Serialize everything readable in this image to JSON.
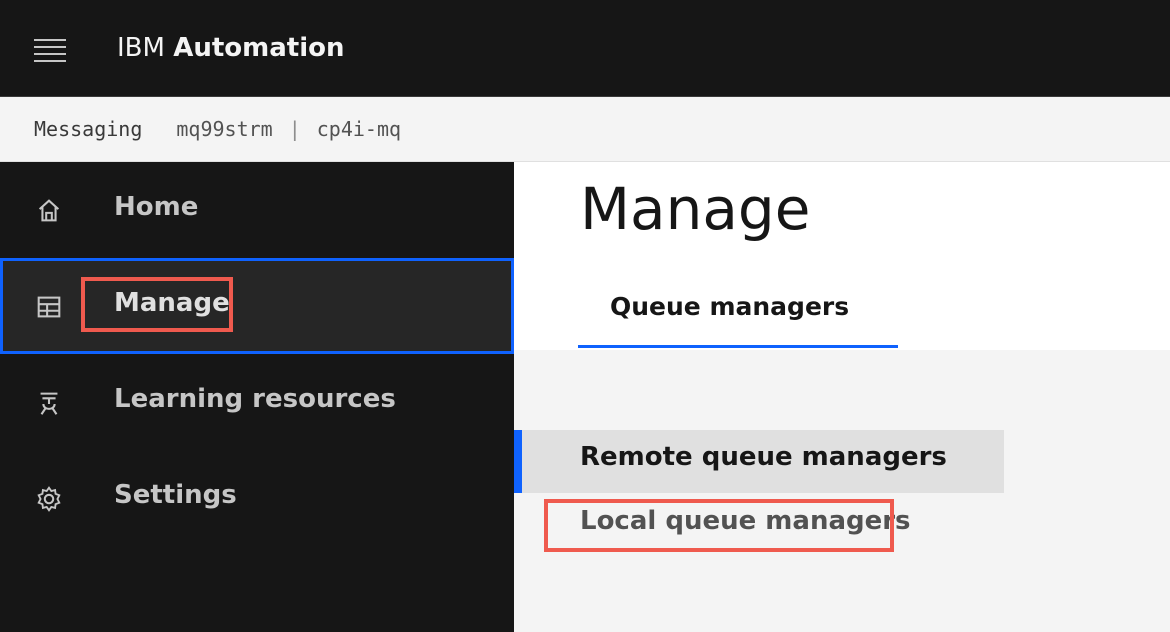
{
  "header": {
    "brand_prefix": "IBM",
    "brand_product": "Automation",
    "menu_icon": "hamburger-menu-icon"
  },
  "context_bar": {
    "root": "Messaging",
    "instance": "mq99strm",
    "separator": "|",
    "namespace": "cp4i-mq"
  },
  "sidenav": {
    "items": [
      {
        "label": "Home",
        "icon": "home-icon"
      },
      {
        "label": "Manage",
        "icon": "table-icon",
        "active": true
      },
      {
        "label": "Learning resources",
        "icon": "learning-icon"
      },
      {
        "label": "Settings",
        "icon": "gear-icon"
      }
    ]
  },
  "main": {
    "title": "Manage",
    "tabs": [
      {
        "label": "Queue managers",
        "selected": true
      }
    ],
    "subnav": [
      {
        "label": "Remote queue managers",
        "selected": true
      },
      {
        "label": "Local queue managers",
        "selected": false
      }
    ]
  },
  "colors": {
    "accent": "#0f62fe",
    "annotation": "#ef5a4e",
    "header_bg": "#161616",
    "content_bg": "#f4f4f4"
  }
}
